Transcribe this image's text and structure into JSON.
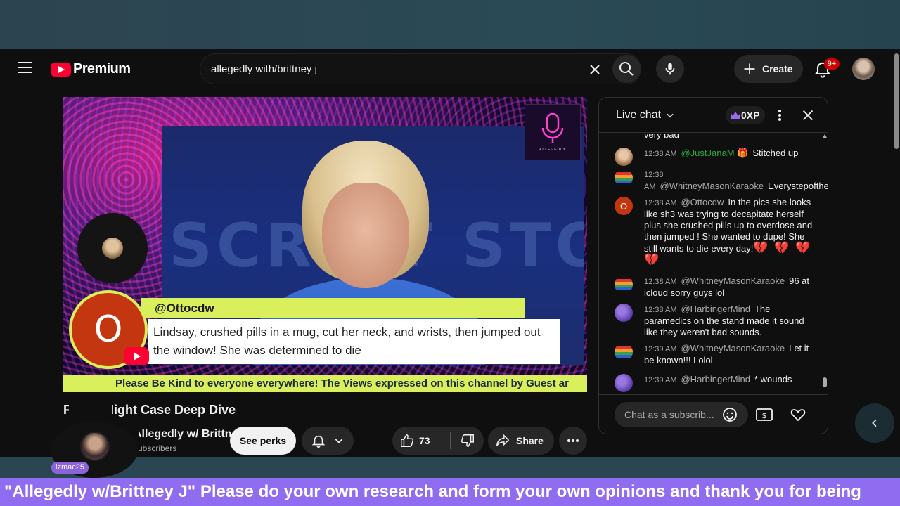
{
  "app": {
    "logo_text": "Premium"
  },
  "search": {
    "query": "allegedly with/brittney j",
    "placeholder": "Search"
  },
  "header": {
    "create_label": "Create",
    "notifications_badge": "9+"
  },
  "player": {
    "highlight": {
      "avatar_letter": "O",
      "author": "@Ottocdw",
      "message": "Lindsay, crushed pills in a mug, cut her neck, and wrists, then jumped out the window! She was determined to die"
    },
    "backdrop_text": "SCRIPT STORIES",
    "ticker": "Please Be Kind to everyone everywhere! The Views expressed on this channel by Guest ar"
  },
  "video": {
    "title": "Friday Night Case Deep Dive",
    "channel_name": "Allegedly w/ Brittney J",
    "subscribers": "subscribers",
    "see_perks": "See perks",
    "likes": "73",
    "share_label": "Share"
  },
  "overlay_user": {
    "tag": "lzmac25"
  },
  "chat": {
    "title": "Live chat",
    "xp": "0XP",
    "top_fragment": "very bad",
    "input_placeholder": "Chat as a subscrib...",
    "messages": [
      {
        "time": "12:38 AM",
        "author": "@JustJanaM 🎁",
        "text": "Stitched up",
        "color": "#c79a74"
      },
      {
        "time": "12:38 AM",
        "author": "@WhitneyMasonKaraoke",
        "text": "Everystepoftheway",
        "color": "rainbow"
      },
      {
        "time": "12:38 AM",
        "author": "@Ottocdw",
        "text": "In the pics she looks like sh3 was trying to decapitate herself plus she crushed pills up to overdose and then jumped ! She wanted to dupe! She still wants to die every day!",
        "hearts": "💔 💔 💔 💔",
        "color": "#c4360f"
      },
      {
        "time": "12:38 AM",
        "author": "@WhitneyMasonKaraoke",
        "text": "96 at icloud sorry guys lol",
        "color": "rainbow"
      },
      {
        "time": "12:38 AM",
        "author": "@HarbingerMind",
        "text": "The paramedics on the stand made it sound like they weren't bad sounds.",
        "color": "#6a4fb8"
      },
      {
        "time": "12:39 AM",
        "author": "@WhitneyMasonKaraoke",
        "text": "Let it be known!!! Lolol",
        "color": "rainbow"
      },
      {
        "time": "12:39 AM",
        "author": "@HarbingerMind",
        "text": "* wounds",
        "color": "#6a4fb8"
      }
    ]
  },
  "marquee": "s \"Allegedly w/Brittney J\" Please do your own research and form your own opinions and thank you for being",
  "colors": {
    "accent_red": "#ff0033",
    "ticker_yellow": "#d9ef5b",
    "marquee_purple": "#8f6cf0",
    "chat_author_green": "#2ba640"
  }
}
